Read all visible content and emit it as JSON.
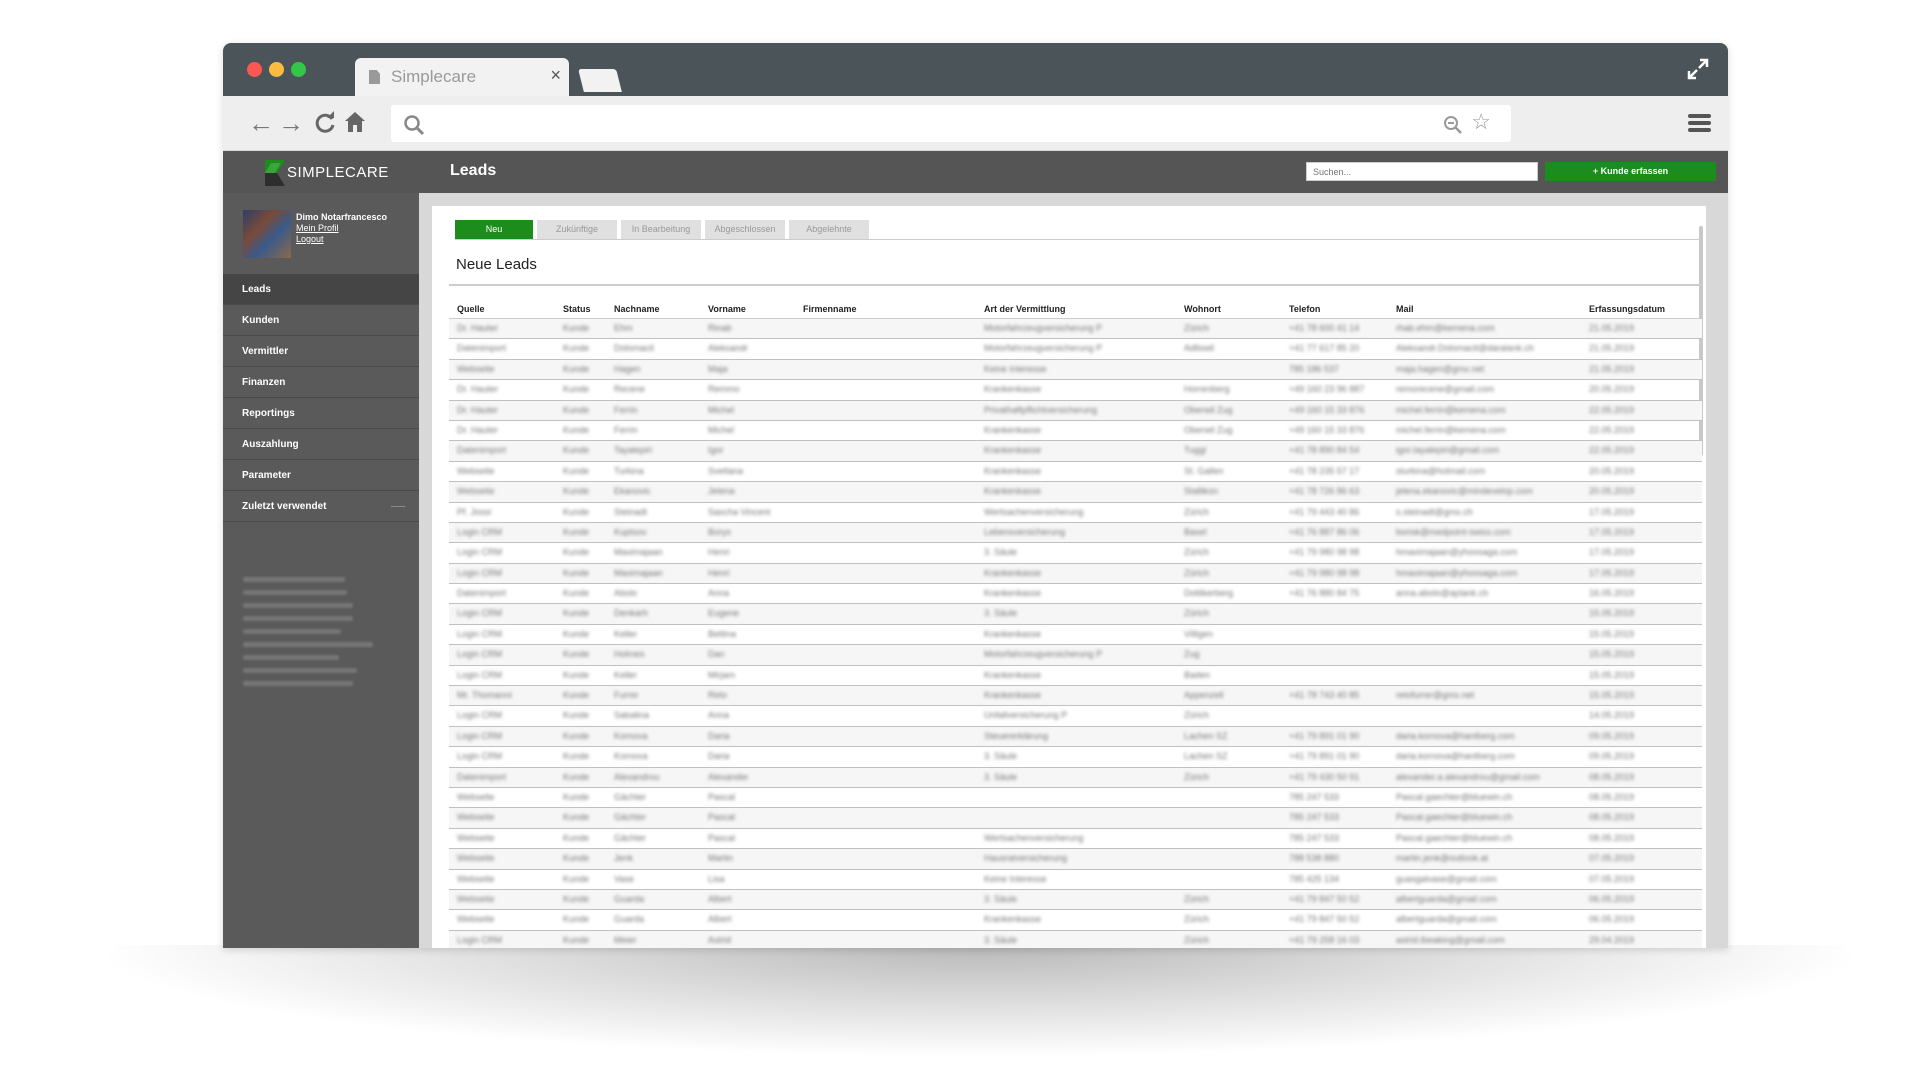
{
  "browser": {
    "tab_title": "Simplecare",
    "tab_close": "×",
    "back": "←",
    "forward": "→",
    "reload": "C",
    "star": "☆"
  },
  "app": {
    "brand": "SIMPLECARE",
    "page_title": "Leads",
    "search_placeholder": "Suchen...",
    "add_button": "+ Kunde erfassen",
    "accent_color": "#1c8c1c"
  },
  "profile": {
    "name": "Dimo Notarfrancesco",
    "my_profile": "Mein Profil",
    "logout": "Logout"
  },
  "sidebar": {
    "items": [
      {
        "label": "Leads"
      },
      {
        "label": "Kunden"
      },
      {
        "label": "Vermittler"
      },
      {
        "label": "Finanzen"
      },
      {
        "label": "Reportings"
      },
      {
        "label": "Auszahlung"
      },
      {
        "label": "Parameter"
      },
      {
        "label": "Zuletzt verwendet"
      }
    ]
  },
  "tabs": [
    {
      "label": "Neu"
    },
    {
      "label": "Zukünftige"
    },
    {
      "label": "In Bearbeitung"
    },
    {
      "label": "Abgeschlossen"
    },
    {
      "label": "Abgelehnte"
    }
  ],
  "section_title": "Neue Leads",
  "table": {
    "columns": [
      "Quelle",
      "Status",
      "Nachname",
      "Vorname",
      "Firmenname",
      "Art der Vermittlung",
      "Wohnort",
      "Telefon",
      "Mail",
      "Erfassungsdatum"
    ],
    "rows": [
      [
        "Dr. Hauter",
        "Kunde",
        "Ehm",
        "Rinab",
        "",
        "Motorfahrzeugversicherung P",
        "Zürich",
        "+41 78 600 41 14",
        "rhab.ehm@kemena.com",
        "21.05.2019"
      ],
      [
        "Datenimport",
        "Kunde",
        "Dolomacit",
        "Aleksandr",
        "",
        "Motorfahrzeugversicherung P",
        "Adliswil",
        "+41 77 617 85 20",
        "Aleksandr.Dolomacit@daralank.ch",
        "21.05.2019"
      ],
      [
        "Webseite",
        "Kunde",
        "Hagen",
        "Maja",
        "",
        "Keine Interesse",
        "",
        "785 186 537",
        "maja.hagen@gmx.net",
        "21.05.2019"
      ],
      [
        "Dr. Hauter",
        "Kunde",
        "Recene",
        "Remmo",
        "",
        "Krankenkasse",
        "Horrenberg",
        "+49 160 23 96 887",
        "remorecene@gmail.com",
        "20.05.2019"
      ],
      [
        "Dr. Hauter",
        "Kunde",
        "Ferrin",
        "Michel",
        "",
        "Privathaftpflichtversicherung",
        "Oberwil Zug",
        "+49 160 15 33 876",
        "michel.ferrin@kemena.com",
        "22.05.2019"
      ],
      [
        "Dr. Hauter",
        "Kunde",
        "Ferrin",
        "Michel",
        "",
        "Krankenkasse",
        "Oberwil Zug",
        "+49 160 15 33 876",
        "michel.ferrin@kemena.com",
        "22.05.2019"
      ],
      [
        "Datenimport",
        "Kunde",
        "Tayalepiri",
        "Igor",
        "",
        "Krankenkasse",
        "Tuggi",
        "+41 78 890 84 54",
        "igor.tayalepiri@gmail.com",
        "22.05.2019"
      ],
      [
        "Webseite",
        "Kunde",
        "Turkina",
        "Svetlana",
        "",
        "Krankenkasse",
        "St. Gallen",
        "+41 78 235 57 17",
        "sturkina@hotmail.com",
        "20.05.2019"
      ],
      [
        "Webseite",
        "Kunde",
        "Ekanovic",
        "Jelena",
        "",
        "Krankenkasse",
        "Stallikon",
        "+41 78 726 86 63",
        "jelena.ekanovic@mindevelop.com",
        "20.05.2019"
      ],
      [
        "Pf. Jossi",
        "Kunde",
        "Steinadt",
        "Sascha Vincent",
        "",
        "Wertsachenversicherung",
        "Zürich",
        "+41 79 443 40 86",
        "s.steinadt@gmx.ch",
        "17.05.2019"
      ],
      [
        "Login CRM",
        "Kunde",
        "Kuptsov",
        "Borys",
        "",
        "Lebensversicherung",
        "Basel",
        "+41 76 887 86 06",
        "borisk@medpoint-swiss.com",
        "17.05.2019"
      ],
      [
        "Login CRM",
        "Kunde",
        "Maximajaan",
        "Henri",
        "",
        "3. Säule",
        "Zürich",
        "+41 79 980 98 98",
        "hmaximajaan@yhoosaga.com",
        "17.05.2019"
      ],
      [
        "Login CRM",
        "Kunde",
        "Maximajaan",
        "Henri",
        "",
        "Krankenkasse",
        "Zürich",
        "+41 79 980 98 98",
        "hmaximajaan@yhoosaga.com",
        "17.05.2019"
      ],
      [
        "Datenimport",
        "Kunde",
        "Abolo",
        "Anna",
        "",
        "Krankenkasse",
        "Dottikerberg",
        "+41 76 880 84 75",
        "anna.abolo@aplank.ch",
        "16.05.2019"
      ],
      [
        "Login CRM",
        "Kunde",
        "Denkarh",
        "Eugene",
        "",
        "3. Säule",
        "Zürich",
        "",
        "",
        "15.05.2019"
      ],
      [
        "Login CRM",
        "Kunde",
        "Keller",
        "Bettina",
        "",
        "Krankenkasse",
        "Villigen",
        "",
        "",
        "15.05.2019"
      ],
      [
        "Login CRM",
        "Kunde",
        "Holmes",
        "Dan",
        "",
        "Motorfahrzeugversicherung P",
        "Zug",
        "",
        "",
        "15.05.2019"
      ],
      [
        "Login CRM",
        "Kunde",
        "Keller",
        "Mirjam",
        "",
        "Krankenkasse",
        "Baden",
        "",
        "",
        "15.05.2019"
      ],
      [
        "Mr. Thomanni",
        "Kunde",
        "Furrer",
        "Reto",
        "",
        "Krankenkasse",
        "Appenzell",
        "+41 78 743 40 85",
        "retofurrer@gmx.net",
        "15.05.2019"
      ],
      [
        "Login CRM",
        "Kunde",
        "Sabalina",
        "Anna",
        "",
        "Unfallversicherung P",
        "Zürich",
        "",
        "",
        "14.05.2019"
      ],
      [
        "Login CRM",
        "Kunde",
        "Kornova",
        "Daria",
        "",
        "Steuererklärung",
        "Lachen SZ",
        "+41 79 891 01 90",
        "daria.kornova@hantberg.com",
        "09.05.2019"
      ],
      [
        "Login CRM",
        "Kunde",
        "Kornova",
        "Daria",
        "",
        "3. Säule",
        "Lachen SZ",
        "+41 79 891 01 90",
        "daria.kornova@hantberg.com",
        "09.05.2019"
      ],
      [
        "Datenimport",
        "Kunde",
        "Alexandrou",
        "Alexander",
        "",
        "3. Säule",
        "Zürich",
        "+41 79 430 50 91",
        "alexander.a.alexandrou@gmail.com",
        "08.05.2019"
      ],
      [
        "Webseite",
        "Kunde",
        "Gächter",
        "Pascal",
        "",
        "",
        "",
        "785 247 533",
        "Pascal.gaechter@bluewin.ch",
        "08.05.2019"
      ],
      [
        "Webseite",
        "Kunde",
        "Gächter",
        "Pascal",
        "",
        "",
        "",
        "785 247 533",
        "Pascal.gaechter@bluewin.ch",
        "08.05.2019"
      ],
      [
        "Webseite",
        "Kunde",
        "Gächter",
        "Pascal",
        "",
        "Wertsachenversicherung",
        "",
        "785 247 533",
        "Pascal.gaechter@bluewin.ch",
        "08.05.2019"
      ],
      [
        "Webseite",
        "Kunde",
        "Jenk",
        "Martin",
        "",
        "Hausratversicherung",
        "",
        "788 538 880",
        "martin.jenk@outlook.at",
        "07.05.2019"
      ],
      [
        "Webseite",
        "Kunde",
        "Vase",
        "Lisa",
        "",
        "Keine Interesse",
        "",
        "785 425 134",
        "guasgalvase@gmail.com",
        "07.05.2019"
      ],
      [
        "Webseite",
        "Kunde",
        "Guarda",
        "Albert",
        "",
        "3. Säule",
        "Zürich",
        "+41 79 847 50 52",
        "albertguarda@gmail.com",
        "06.05.2019"
      ],
      [
        "Webseite",
        "Kunde",
        "Guarda",
        "Albert",
        "",
        "Krankenkasse",
        "Zürich",
        "+41 79 847 50 52",
        "albertguarda@gmail.com",
        "06.05.2019"
      ],
      [
        "Login CRM",
        "Kunde",
        "Meier",
        "Astrid",
        "",
        "3. Säule",
        "Zürich",
        "+41 79 258 16 03",
        "astrid.tbeaking@gmail.com",
        "29.04.2019"
      ]
    ]
  },
  "recent_items": [
    "Simplesare.ch AG",
    "Dietrics Gomiakos",
    "Beeks Dino Aleksandr",
    "Ferrin Gino Soras AG",
    "Pascal Gächter",
    "Alpine Education Services GmbH",
    "Sussell Gains",
    "Williars Sake Hasst AG",
    "Natasha Von Colenken"
  ]
}
